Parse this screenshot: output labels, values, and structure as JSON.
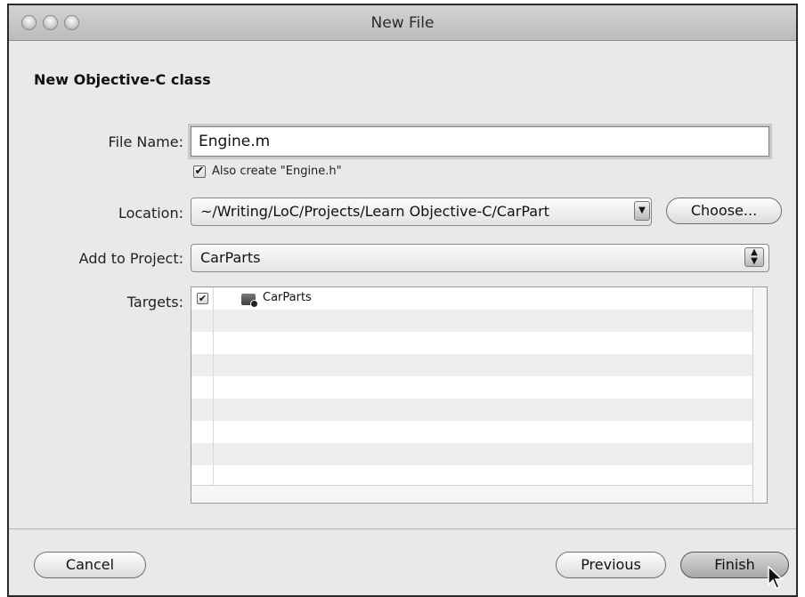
{
  "window": {
    "title": "New File"
  },
  "dialog": {
    "heading": "New Objective-C class",
    "file_name_label": "File Name:",
    "file_name_value": "Engine.m",
    "also_create_label": "Also create \"Engine.h\"",
    "also_create_checked": "✔",
    "location_label": "Location:",
    "location_value": "~/Writing/LoC/Projects/Learn Objective-C/CarPart",
    "choose_label": "Choose...",
    "add_to_project_label": "Add to Project:",
    "add_to_project_value": "CarParts",
    "targets_label": "Targets:",
    "targets": [
      {
        "name": "CarParts",
        "checked": "✔"
      }
    ]
  },
  "footer": {
    "cancel_label": "Cancel",
    "previous_label": "Previous",
    "finish_label": "Finish"
  }
}
